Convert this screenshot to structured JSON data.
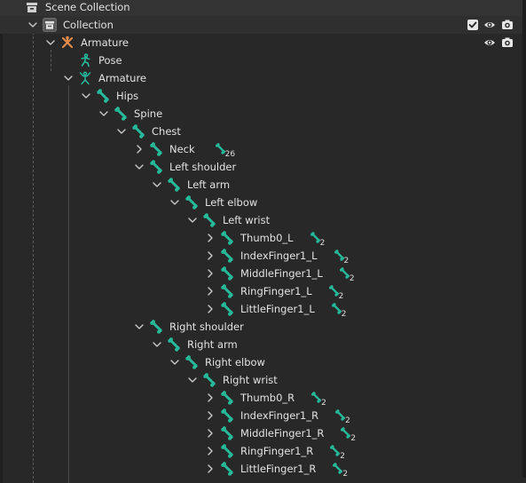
{
  "outliner": {
    "rows": [
      {
        "label": "Scene Collection",
        "depth": 0,
        "icon": "scene-collection",
        "chevron": "none"
      },
      {
        "label": "Collection",
        "depth": 1,
        "icon": "collection",
        "chevron": "down",
        "controls": [
          "checkbox",
          "eye",
          "camera"
        ]
      },
      {
        "label": "Armature",
        "depth": 2,
        "icon": "armature-object",
        "chevron": "down",
        "controls": [
          "eye",
          "camera"
        ]
      },
      {
        "label": "Pose",
        "depth": 3,
        "icon": "pose",
        "chevron": "none"
      },
      {
        "label": "Armature",
        "depth": 3,
        "icon": "armature-data",
        "chevron": "down"
      },
      {
        "label": "Hips",
        "depth": 4,
        "icon": "bone",
        "chevron": "down"
      },
      {
        "label": "Spine",
        "depth": 5,
        "icon": "bone",
        "chevron": "down"
      },
      {
        "label": "Chest",
        "depth": 6,
        "icon": "bone",
        "chevron": "down"
      },
      {
        "label": "Neck",
        "depth": 7,
        "icon": "bone",
        "chevron": "right",
        "badge": "26"
      },
      {
        "label": "Left shoulder",
        "depth": 7,
        "icon": "bone",
        "chevron": "down"
      },
      {
        "label": "Left arm",
        "depth": 8,
        "icon": "bone",
        "chevron": "down"
      },
      {
        "label": "Left elbow",
        "depth": 9,
        "icon": "bone",
        "chevron": "down"
      },
      {
        "label": "Left wrist",
        "depth": 10,
        "icon": "bone",
        "chevron": "down"
      },
      {
        "label": "Thumb0_L",
        "depth": 11,
        "icon": "bone",
        "chevron": "right",
        "badge": "2"
      },
      {
        "label": "IndexFinger1_L",
        "depth": 11,
        "icon": "bone",
        "chevron": "right",
        "badge": "2"
      },
      {
        "label": "MiddleFinger1_L",
        "depth": 11,
        "icon": "bone",
        "chevron": "right",
        "badge": "2"
      },
      {
        "label": "RingFinger1_L",
        "depth": 11,
        "icon": "bone",
        "chevron": "right",
        "badge": "2"
      },
      {
        "label": "LittleFinger1_L",
        "depth": 11,
        "icon": "bone",
        "chevron": "right",
        "badge": "2"
      },
      {
        "label": "Right shoulder",
        "depth": 7,
        "icon": "bone",
        "chevron": "down"
      },
      {
        "label": "Right arm",
        "depth": 8,
        "icon": "bone",
        "chevron": "down"
      },
      {
        "label": "Right elbow",
        "depth": 9,
        "icon": "bone",
        "chevron": "down"
      },
      {
        "label": "Right wrist",
        "depth": 10,
        "icon": "bone",
        "chevron": "down"
      },
      {
        "label": "Thumb0_R",
        "depth": 11,
        "icon": "bone",
        "chevron": "right",
        "badge": "2"
      },
      {
        "label": "IndexFinger1_R",
        "depth": 11,
        "icon": "bone",
        "chevron": "right",
        "badge": "2"
      },
      {
        "label": "MiddleFinger1_R",
        "depth": 11,
        "icon": "bone",
        "chevron": "right",
        "badge": "2"
      },
      {
        "label": "RingFinger1_R",
        "depth": 11,
        "icon": "bone",
        "chevron": "right",
        "badge": "2"
      },
      {
        "label": "LittleFinger1_R",
        "depth": 11,
        "icon": "bone",
        "chevron": "right",
        "badge": "2"
      }
    ]
  },
  "colors": {
    "background": "#282828",
    "bone": "#26b99a",
    "armature_object": "#e08a4b",
    "text": "#e2e2e2"
  }
}
